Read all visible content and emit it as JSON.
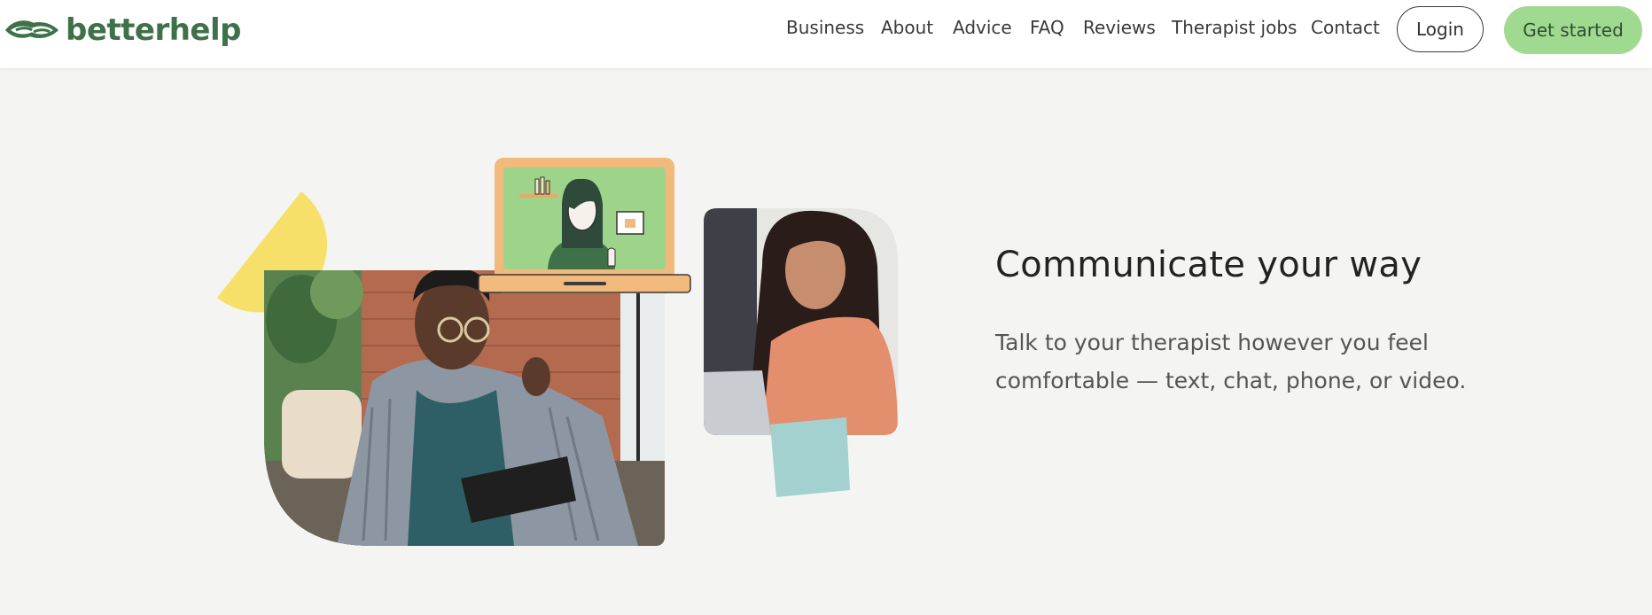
{
  "brand": {
    "name": "betterhelp",
    "color": "#3e7148"
  },
  "nav": {
    "items": [
      "Business",
      "About",
      "Advice",
      "FAQ",
      "Reviews",
      "Therapist jobs",
      "Contact"
    ],
    "login_label": "Login",
    "cta_label": "Get started"
  },
  "hero": {
    "headline": "Communicate your way",
    "body": "Talk to your therapist however you feel comfortable — text, chat, phone, or video."
  },
  "colors": {
    "accent_green": "#a0da90",
    "background": "#f4f5f2",
    "yellow_shape": "#f7e06a",
    "teal_shape": "#a2d1cf",
    "laptop_frame": "#f2b97d"
  }
}
